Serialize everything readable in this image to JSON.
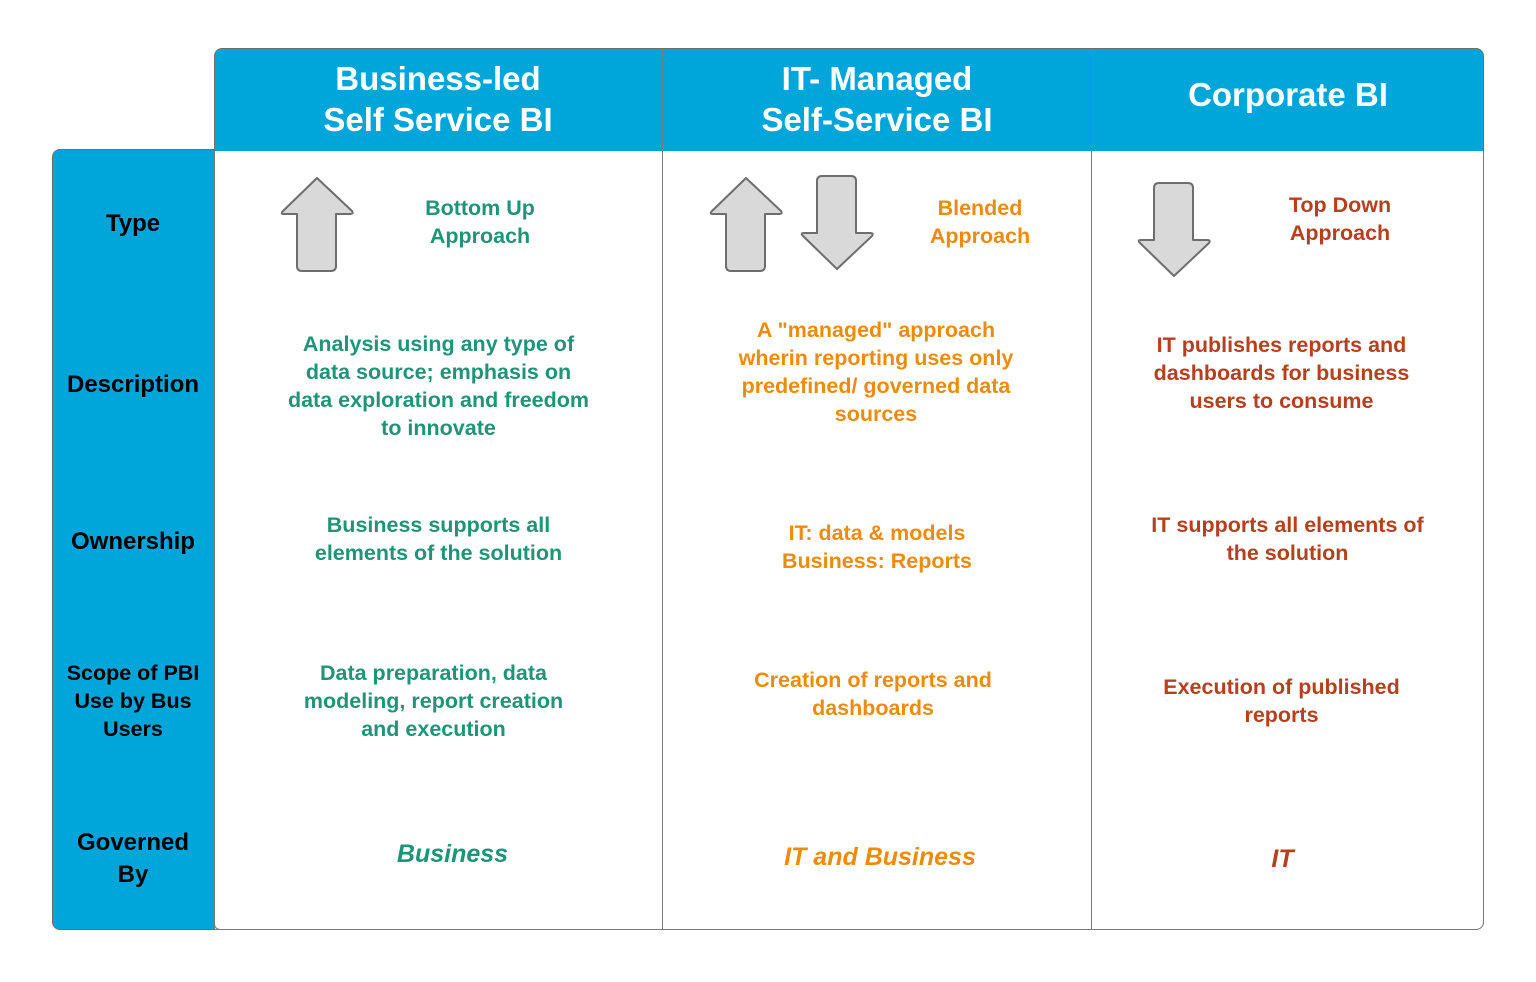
{
  "columns": [
    {
      "title": "Business-led\nSelf Service BI",
      "color": "#1e9478"
    },
    {
      "title": "IT- Managed\nSelf-Service BI",
      "color": "#ec8b0c"
    },
    {
      "title": "Corporate BI",
      "color": "#b4401e"
    }
  ],
  "rows": [
    {
      "label": "Type",
      "cells": [
        {
          "text": "Bottom Up\nApproach",
          "icons": [
            "arrow-up-icon"
          ]
        },
        {
          "text": "Blended\nApproach",
          "icons": [
            "arrow-up-icon",
            "arrow-down-icon"
          ]
        },
        {
          "text": "Top Down\nApproach",
          "icons": [
            "arrow-down-icon"
          ]
        }
      ]
    },
    {
      "label": "Description",
      "cells": [
        {
          "text": "Analysis using any type of\ndata source; emphasis on\ndata exploration and freedom\nto innovate"
        },
        {
          "text": "A \"managed\" approach\nwherin reporting uses only\npredefined/ governed data\nsources"
        },
        {
          "text": "IT publishes reports and\ndashboards for business\nusers to consume"
        }
      ]
    },
    {
      "label": "Ownership",
      "cells": [
        {
          "text": "Business supports all\nelements of the solution"
        },
        {
          "text": "IT: data & models\nBusiness: Reports"
        },
        {
          "text": "IT supports all elements of\nthe solution"
        }
      ]
    },
    {
      "label": "Scope of PBI\nUse by Bus\nUsers",
      "cells": [
        {
          "text": "Data preparation, data\nmodeling, report creation\nand execution"
        },
        {
          "text": "Creation of reports and\ndashboards"
        },
        {
          "text": "Execution of published\nreports"
        }
      ]
    },
    {
      "label": "Governed\nBy",
      "cells": [
        {
          "text": "Business"
        },
        {
          "text": "IT and Business"
        },
        {
          "text": "IT"
        }
      ]
    }
  ],
  "colors": {
    "header_bg": "#00a6d9",
    "arrow_fill": "#d9d9d9",
    "arrow_stroke": "#6d6d6d",
    "border": "#7a7a7a"
  }
}
